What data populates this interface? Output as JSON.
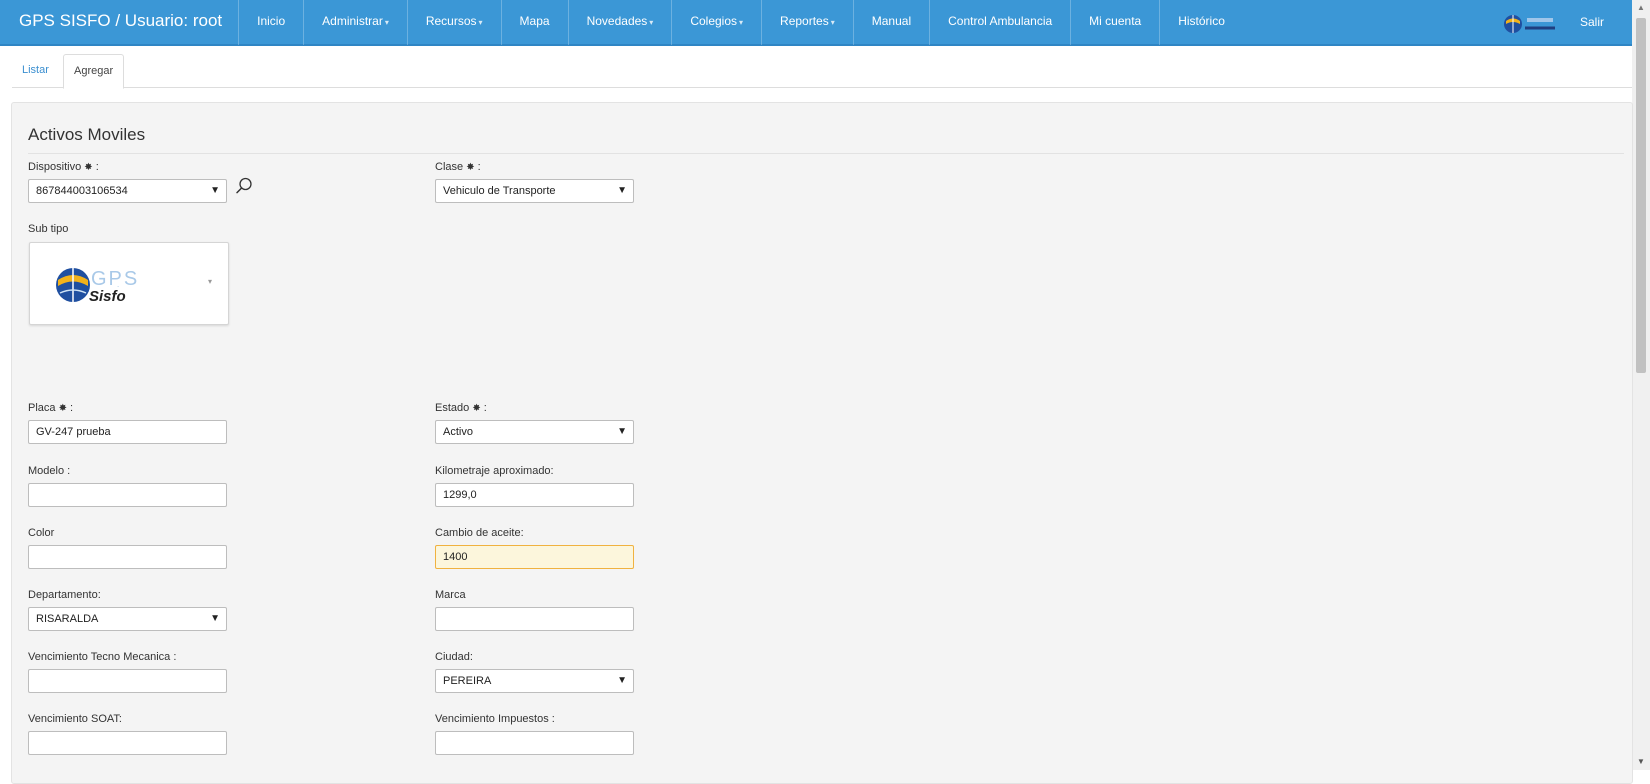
{
  "navbar": {
    "brand": "GPS SISFO / Usuario: root",
    "items": [
      {
        "label": "Inicio",
        "dropdown": false
      },
      {
        "label": "Administrar",
        "dropdown": true
      },
      {
        "label": "Recursos",
        "dropdown": true
      },
      {
        "label": "Mapa",
        "dropdown": false
      },
      {
        "label": "Novedades",
        "dropdown": true
      },
      {
        "label": "Colegios",
        "dropdown": true
      },
      {
        "label": "Reportes",
        "dropdown": true
      },
      {
        "label": "Manual",
        "dropdown": false
      },
      {
        "label": "Control Ambulancia",
        "dropdown": false
      },
      {
        "label": "Mi cuenta",
        "dropdown": false
      },
      {
        "label": "Histórico",
        "dropdown": false
      }
    ],
    "caret": "▾",
    "exit": "Salir",
    "colors": {
      "bar": "#3b97d6",
      "text": "#ffffff"
    }
  },
  "tabs": {
    "list": "Listar",
    "add": "Agregar"
  },
  "form": {
    "title": "Activos Moviles",
    "required_mark": "✸",
    "dispositivo": {
      "label": "Dispositivo",
      "suffix": ":",
      "value": "867844003106534"
    },
    "clase": {
      "label": "Clase",
      "suffix": ":",
      "value": "Vehiculo de Transporte"
    },
    "sub_tipo": {
      "label": "Sub tipo"
    },
    "placa": {
      "label": "Placa",
      "suffix": ":",
      "value": "GV-247 prueba"
    },
    "estado": {
      "label": "Estado",
      "suffix": ":",
      "value": "Activo"
    },
    "modelo": {
      "label": "Modelo :",
      "value": ""
    },
    "kilometraje": {
      "label": "Kilometraje aproximado:",
      "value": "1299,0"
    },
    "color": {
      "label": "Color",
      "value": ""
    },
    "cambio_aceite": {
      "label": "Cambio de aceite:",
      "value": "1400"
    },
    "departamento": {
      "label": "Departamento:",
      "value": "RISARALDA"
    },
    "marca": {
      "label": "Marca",
      "value": ""
    },
    "vencimiento_tecno": {
      "label": "Vencimiento Tecno Mecanica :",
      "value": ""
    },
    "ciudad": {
      "label": "Ciudad:",
      "value": "PEREIRA"
    },
    "vencimiento_soat": {
      "label": "Vencimiento SOAT:",
      "value": ""
    },
    "vencimiento_impuestos": {
      "label": "Vencimiento Impuestos :",
      "value": ""
    },
    "select_arrow": "▼"
  },
  "icons": [
    "search-icon",
    "gps-sisfo-logo",
    "scroll-up-icon",
    "scroll-down-icon"
  ]
}
